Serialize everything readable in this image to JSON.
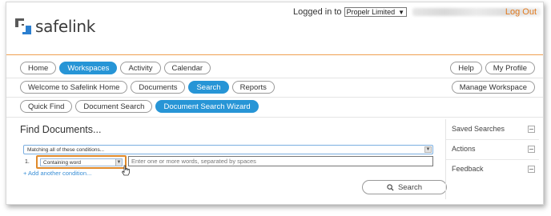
{
  "brand": {
    "name": "safelink",
    "colors": {
      "accent": "#2795d6",
      "highlight": "#e08a2a",
      "logo_blue": "#2b7fd0",
      "logo_grey": "#5a5a5a"
    }
  },
  "header": {
    "logged_in_label": "Logged in to",
    "organisation": "Propelr Limited",
    "logout_label": "Log Out"
  },
  "nav": {
    "main": [
      "Home",
      "Workspaces",
      "Activity",
      "Calendar"
    ],
    "main_active": "Workspaces",
    "utility": [
      "Help",
      "My Profile"
    ],
    "workspace_tabs": [
      "Welcome to Safelink Home",
      "Documents",
      "Search",
      "Reports"
    ],
    "workspace_active": "Search",
    "manage_label": "Manage Workspace",
    "search_tabs": [
      "Quick Find",
      "Document Search",
      "Document Search Wizard"
    ],
    "search_active": "Document Search Wizard"
  },
  "find": {
    "title": "Find Documents...",
    "match_mode": "Matching all of these conditions...",
    "row_number": "1.",
    "condition": "Containing word",
    "terms_placeholder": "Enter one or more words, separated by spaces",
    "add_condition": "+ Add another condition...",
    "search_button": "Search"
  },
  "sidebar": {
    "panels": [
      "Saved Searches",
      "Actions",
      "Feedback"
    ]
  }
}
